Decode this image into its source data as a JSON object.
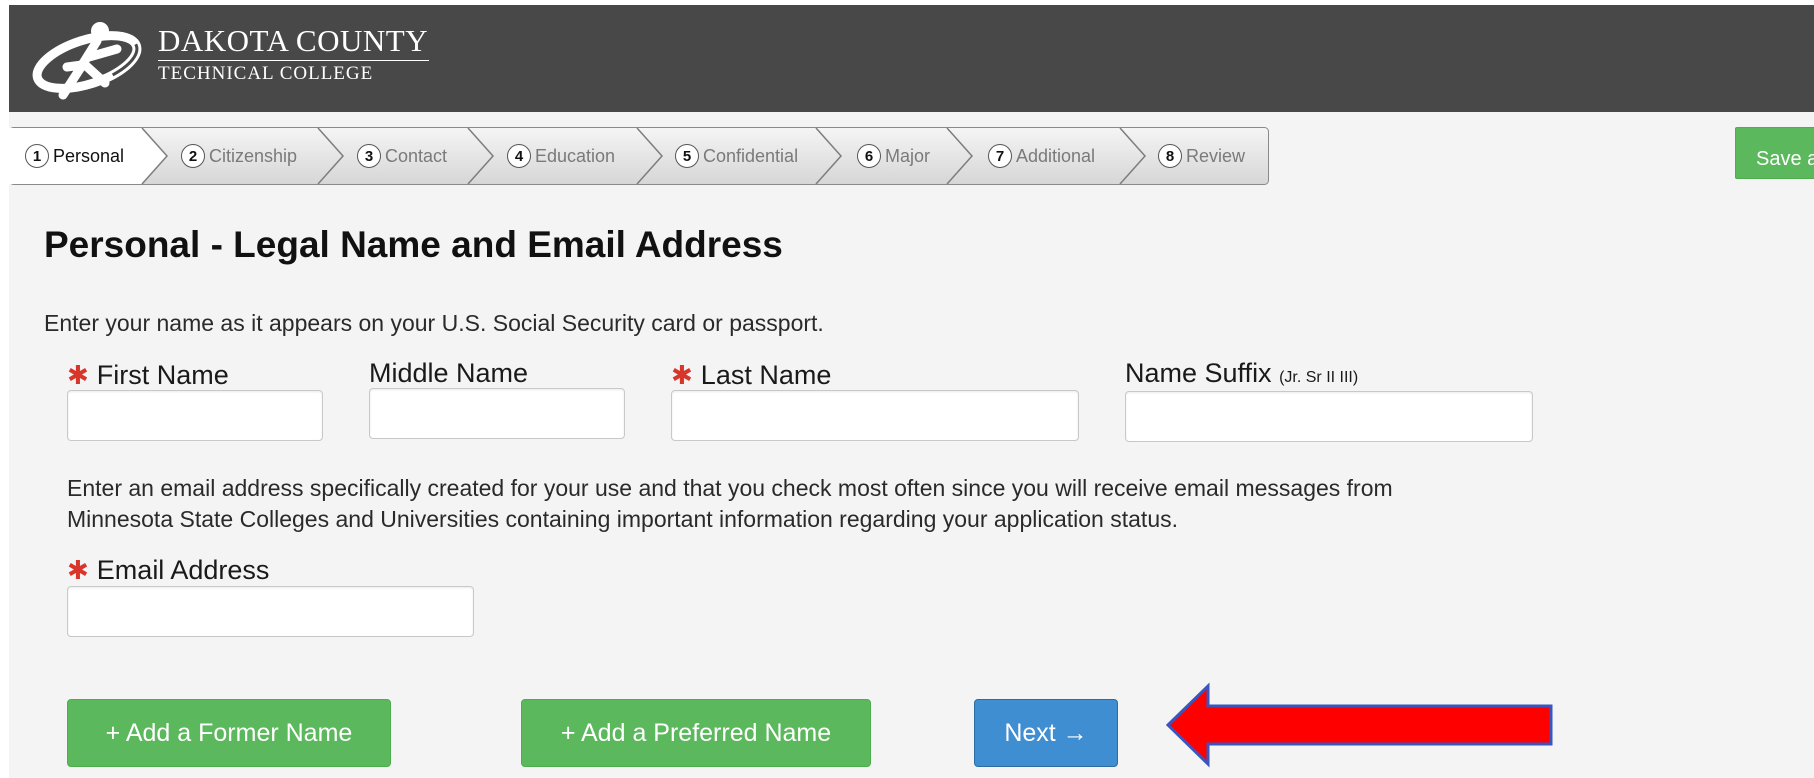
{
  "header": {
    "college_name_line1": "DAKOTA COUNTY",
    "college_name_line2": "TECHNICAL COLLEGE",
    "logo_icon": "dcte-runner-logo"
  },
  "steps": [
    {
      "number": "1",
      "label": "Personal",
      "active": true
    },
    {
      "number": "2",
      "label": "Citizenship",
      "active": false
    },
    {
      "number": "3",
      "label": "Contact",
      "active": false
    },
    {
      "number": "4",
      "label": "Education",
      "active": false
    },
    {
      "number": "5",
      "label": "Confidential",
      "active": false
    },
    {
      "number": "6",
      "label": "Major",
      "active": false
    },
    {
      "number": "7",
      "label": "Additional",
      "active": false
    },
    {
      "number": "8",
      "label": "Review",
      "active": false
    }
  ],
  "toolbar": {
    "save_label": "Save a"
  },
  "main": {
    "title": "Personal - Legal Name and Email Address",
    "name_instructions": "Enter your name as it appears on your U.S. Social Security card or passport.",
    "required_marker": "✱",
    "fields": {
      "first_name": {
        "label": "First Name",
        "value": "",
        "required": true
      },
      "middle_name": {
        "label": "Middle Name",
        "value": "",
        "required": false
      },
      "last_name": {
        "label": "Last Name",
        "value": "",
        "required": true
      },
      "name_suffix": {
        "label": "Name Suffix",
        "hint": "(Jr. Sr II III)",
        "value": "",
        "required": false
      },
      "email": {
        "label": "Email Address",
        "value": "",
        "required": true
      }
    },
    "email_instructions": "Enter an email address specifically created for your use and that you check most often since you will receive email messages from Minnesota State Colleges and Universities containing important information regarding your application status."
  },
  "actions": {
    "add_former_name": "+ Add a Former Name",
    "add_preferred_name": "+ Add a Preferred Name",
    "next": "Next →"
  },
  "colors": {
    "header_bg": "#484848",
    "page_bg": "#f4f4f4",
    "success_green": "#5cb85c",
    "primary_blue": "#3f8ed1",
    "required_red": "#d9362b",
    "annotation_arrow_red": "#ff0000"
  }
}
